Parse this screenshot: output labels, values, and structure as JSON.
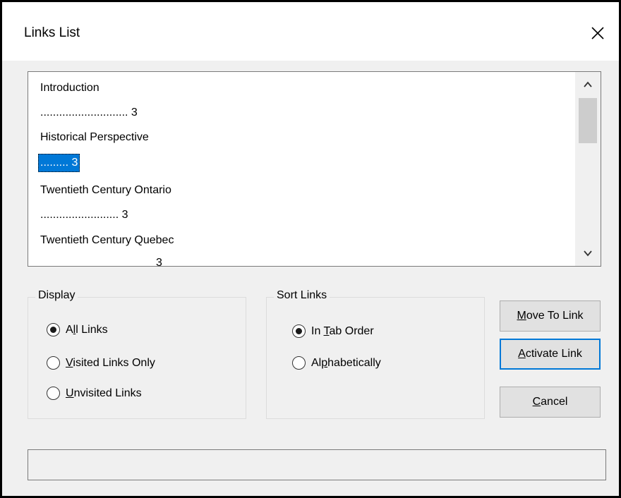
{
  "window": {
    "title": "Links List"
  },
  "links_list": {
    "items": [
      {
        "label": "Introduction",
        "selected": false
      },
      {
        "label": "............................ 3",
        "selected": false
      },
      {
        "label": "Historical Perspective",
        "selected": false
      },
      {
        "label": "......... 3",
        "selected": true
      },
      {
        "label": "Twentieth Century Ontario",
        "selected": false
      },
      {
        "label": "......................... 3",
        "selected": false
      },
      {
        "label": "Twentieth Century Quebec",
        "selected": false
      },
      {
        "label": "3",
        "selected": false
      }
    ]
  },
  "display": {
    "legend": "Display",
    "options": [
      {
        "pre": "A",
        "underline": "l",
        "post": "l Links",
        "checked": true
      },
      {
        "pre": "",
        "underline": "V",
        "post": "isited Links Only",
        "checked": false
      },
      {
        "pre": "",
        "underline": "U",
        "post": "nvisited Links",
        "checked": false
      }
    ]
  },
  "sort_links": {
    "legend": "Sort Links",
    "options": [
      {
        "pre": "In ",
        "underline": "T",
        "post": "ab Order",
        "checked": true
      },
      {
        "pre": "Al",
        "underline": "p",
        "post": "habetically",
        "checked": false
      }
    ]
  },
  "buttons": {
    "move_to_link": {
      "pre": "",
      "underline": "M",
      "post": "ove To Link"
    },
    "activate_link": {
      "pre": "",
      "underline": "A",
      "post": "ctivate Link"
    },
    "cancel": {
      "pre": "",
      "underline": "C",
      "post": "ancel"
    }
  },
  "status": {
    "text": ""
  }
}
